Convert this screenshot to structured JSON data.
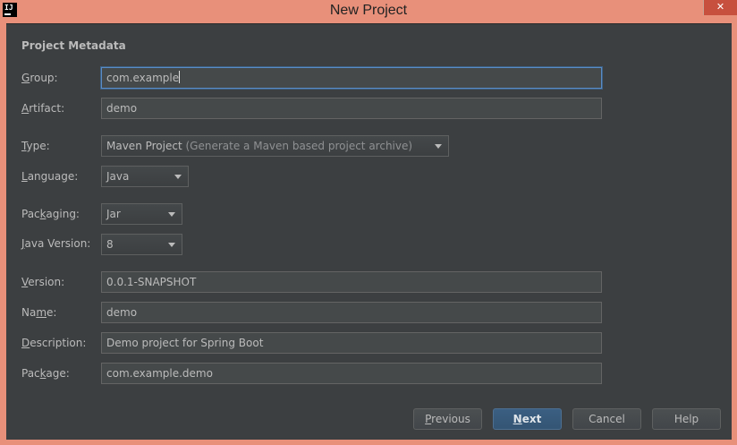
{
  "window": {
    "title": "New Project",
    "app_icon_text": "IJ",
    "close_glyph": "✕"
  },
  "section": {
    "title": "Project Metadata"
  },
  "fields": {
    "group": {
      "label_mn": "G",
      "label_rest": "roup:",
      "value": "com.example"
    },
    "artifact": {
      "label_mn": "A",
      "label_rest": "rtifact:",
      "value": "demo"
    },
    "type": {
      "label_mn": "T",
      "label_rest": "ype:",
      "value": "Maven Project",
      "hint": "(Generate a Maven based project archive)"
    },
    "language": {
      "label_mn": "L",
      "label_rest": "anguage:",
      "value": "Java"
    },
    "packaging": {
      "label_pre": "Pac",
      "label_mn": "k",
      "label_rest": "aging:",
      "value": "Jar"
    },
    "java_version": {
      "label_pre": "",
      "label_mn": "J",
      "label_rest": "ava Version:",
      "value": "8"
    },
    "version": {
      "label_mn": "V",
      "label_rest": "ersion:",
      "value": "0.0.1-SNAPSHOT"
    },
    "name": {
      "label_pre": "Na",
      "label_mn": "m",
      "label_rest": "e:",
      "value": "demo"
    },
    "description": {
      "label_mn": "D",
      "label_rest": "escription:",
      "value": "Demo project for Spring Boot"
    },
    "package": {
      "label_pre": "Pac",
      "label_mn": "k",
      "label_rest": "age:",
      "value": "com.example.demo"
    }
  },
  "buttons": {
    "previous": {
      "mn": "P",
      "rest": "revious"
    },
    "next": {
      "mn": "N",
      "rest": "ext"
    },
    "cancel": "Cancel",
    "help": "Help"
  },
  "colors": {
    "titlebar": "#e8907a",
    "dialog_bg": "#3c3f41",
    "field_bg": "#45494a",
    "accent": "#5a8cc6",
    "default_button": "#365880"
  }
}
